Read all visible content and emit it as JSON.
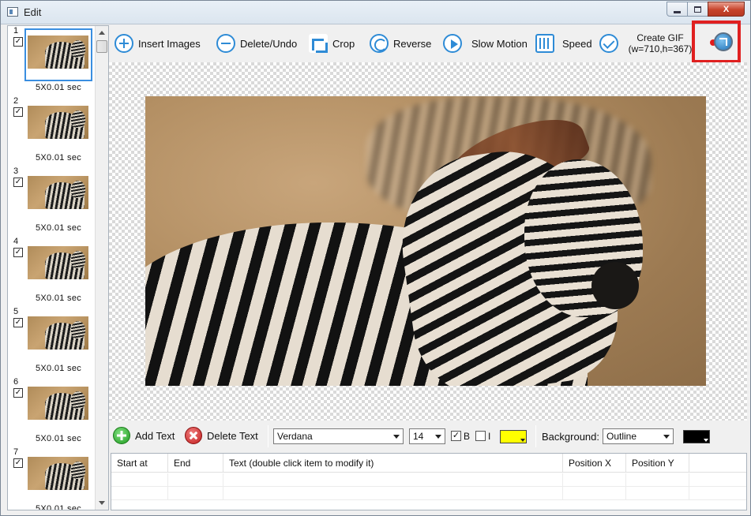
{
  "window": {
    "title": "Edit",
    "controls": {
      "minimize": "—",
      "maximize": "□",
      "close": "X"
    }
  },
  "frames": [
    {
      "number": "1",
      "checked": true,
      "duration": "5X0.01 sec",
      "selected": true
    },
    {
      "number": "2",
      "checked": true,
      "duration": "5X0.01 sec",
      "selected": false
    },
    {
      "number": "3",
      "checked": true,
      "duration": "5X0.01 sec",
      "selected": false
    },
    {
      "number": "4",
      "checked": true,
      "duration": "5X0.01 sec",
      "selected": false
    },
    {
      "number": "5",
      "checked": true,
      "duration": "5X0.01 sec",
      "selected": false
    },
    {
      "number": "6",
      "checked": true,
      "duration": "5X0.01 sec",
      "selected": false
    },
    {
      "number": "7",
      "checked": true,
      "duration": "5X0.01 sec",
      "selected": false
    }
  ],
  "toolbar": {
    "insert_images": "Insert Images",
    "delete_undo": "Delete/Undo",
    "crop": "Crop",
    "reverse": "Reverse",
    "slow_motion": "Slow Motion",
    "speed": "Speed",
    "create_gif_line1": "Create GIF",
    "create_gif_line2": "(w=710,h=367)"
  },
  "text_toolbar": {
    "add_text": "Add Text",
    "delete_text": "Delete Text",
    "font": "Verdana",
    "font_size": "14",
    "bold_label": "B",
    "bold_checked": true,
    "italic_label": "I",
    "italic_checked": false,
    "text_color": "#ffff00",
    "background_label": "Background:",
    "background_value": "Outline",
    "background_color": "#000000"
  },
  "table": {
    "columns": [
      "Start at",
      "End",
      "Text (double click item to modify it)",
      "Position X",
      "Position Y"
    ]
  },
  "colors": {
    "accent": "#2e8bd6",
    "highlight": "#e02020",
    "selection": "#3a8ee0"
  },
  "icons": {
    "insert": "plus-circle-icon",
    "delete": "minus-circle-icon",
    "crop": "crop-icon",
    "reverse": "reverse-icon",
    "slow_motion": "play-icon",
    "speed": "speed-icon",
    "create_gif": "check-circle-icon",
    "pin": "pin-arrow-icon"
  }
}
